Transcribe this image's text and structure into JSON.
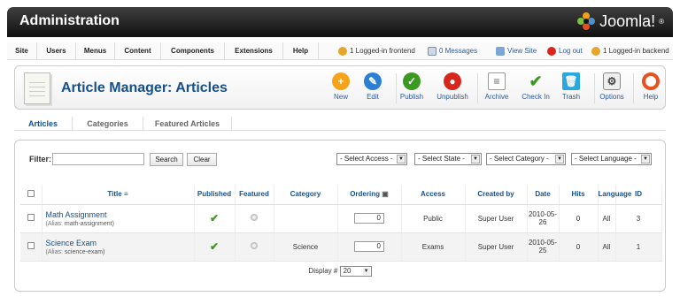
{
  "header": {
    "title": "Administration",
    "logo_text": "Joomla!",
    "logo_reg": "®"
  },
  "menu": {
    "items": [
      "Site",
      "Users",
      "Menus",
      "Content",
      "Components",
      "Extensions",
      "Help"
    ]
  },
  "status": {
    "frontend": "1 Logged-in frontend",
    "messages": "0 Messages",
    "view_site": "View Site",
    "logout": "Log out",
    "backend": "1 Logged-in backend"
  },
  "toolbar": {
    "title": "Article Manager: Articles",
    "buttons": [
      {
        "label": "New",
        "icon": "plus-icon",
        "color": "#f6a21a"
      },
      {
        "label": "Edit",
        "icon": "pencil-icon",
        "color": "#2b7fd6"
      },
      {
        "label": "Publish",
        "icon": "check-icon",
        "color": "#3a9a1f"
      },
      {
        "label": "Unpublish",
        "icon": "unpublish-icon",
        "color": "#d9261c"
      },
      {
        "label": "Archive",
        "icon": "archive-icon",
        "color": "#999999"
      },
      {
        "label": "Check In",
        "icon": "checkin-icon",
        "color": "#3a9a1f"
      },
      {
        "label": "Trash",
        "icon": "trash-icon",
        "color": "#2aa7dc"
      },
      {
        "label": "Options",
        "icon": "options-icon",
        "color": "#888888"
      },
      {
        "label": "Help",
        "icon": "help-icon",
        "color": "#e8501f"
      }
    ]
  },
  "subtabs": [
    "Articles",
    "Categories",
    "Featured Articles"
  ],
  "filter": {
    "label": "Filter:",
    "search_value": "",
    "search_btn": "Search",
    "clear_btn": "Clear",
    "selects": [
      "- Select Access -",
      "- Select State -",
      "- Select Category -",
      "- Select Language -"
    ]
  },
  "table": {
    "columns": [
      "Title",
      "Published",
      "Featured",
      "Category",
      "Ordering",
      "Access",
      "Created by",
      "Date",
      "Hits",
      "Language",
      "ID"
    ],
    "rows": [
      {
        "title": "Math Assignment",
        "alias_label": "(Alias:",
        "alias": "math-assignment)",
        "category": "",
        "ordering": "0",
        "access": "Public",
        "created_by": "Super User",
        "date": "2010-05-26",
        "hits": "0",
        "language": "All",
        "id": "3"
      },
      {
        "title": "Science Exam",
        "alias_label": "(Alias:",
        "alias": "science-exam)",
        "category": "Science",
        "ordering": "0",
        "access": "Exams",
        "created_by": "Super User",
        "date": "2010-05-25",
        "hits": "0",
        "language": "All",
        "id": "1"
      }
    ]
  },
  "pager": {
    "label": "Display #",
    "value": "20"
  }
}
